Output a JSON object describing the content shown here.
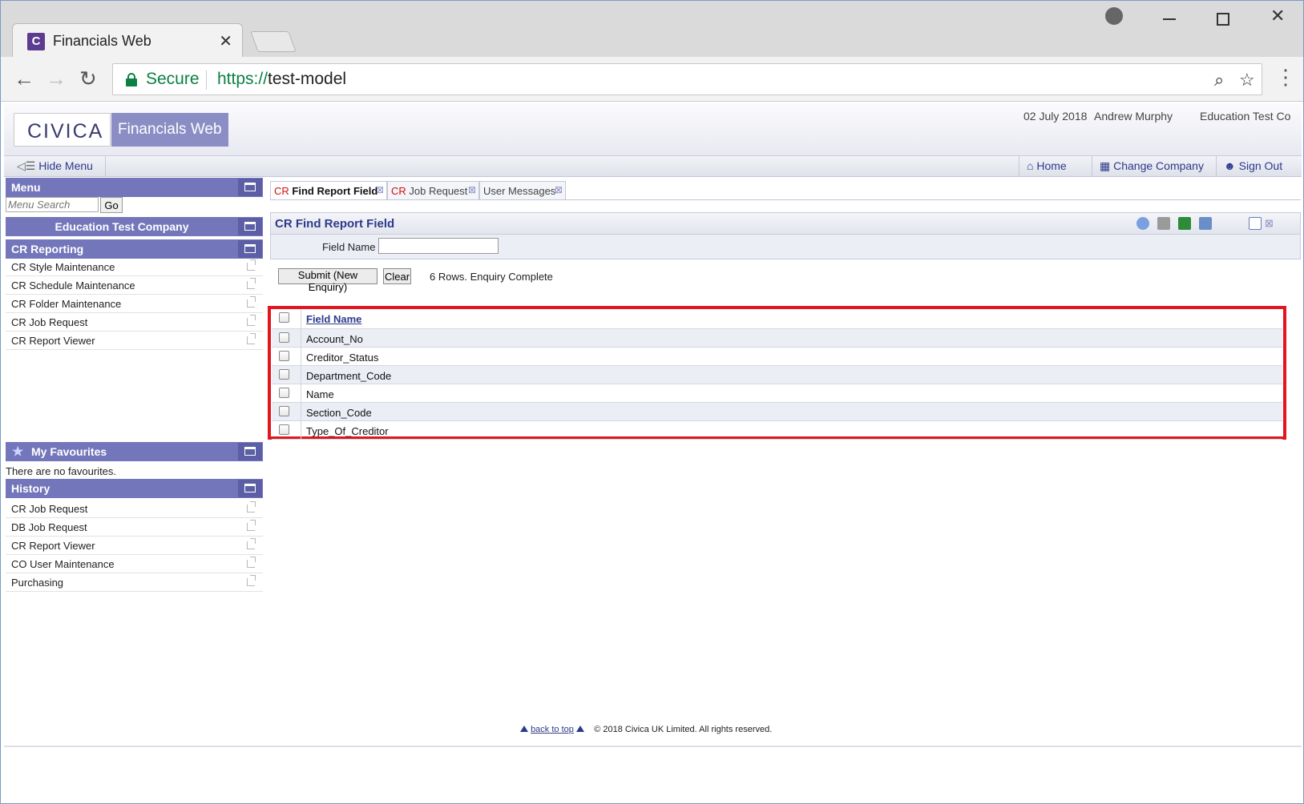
{
  "browser": {
    "tab_title": "Financials Web",
    "tab_favicon": "C",
    "tab_close": "✕",
    "secure_label": "Secure",
    "url_scheme": "https://",
    "url_host": "test-model"
  },
  "header": {
    "logo": "CIVICA",
    "product": "Financials Web",
    "date": "02 July 2018",
    "user": "Andrew Murphy",
    "company": "Education Test Co"
  },
  "toolbar": {
    "hide_menu": "Hide Menu",
    "home": "Home",
    "change_company": "Change Company",
    "sign_out": "Sign Out"
  },
  "sidebar": {
    "menu_title": "Menu",
    "search_placeholder": "Menu Search",
    "go_label": "Go",
    "company_title": "Education Test Company",
    "section_title": "CR Reporting",
    "items": [
      {
        "label": "CR Style Maintenance"
      },
      {
        "label": "CR Schedule Maintenance"
      },
      {
        "label": "CR Folder Maintenance"
      },
      {
        "label": "CR Job Request"
      },
      {
        "label": "CR Report Viewer"
      }
    ],
    "favourites_title": "My Favourites",
    "no_favourites": "There are no favourites.",
    "history_title": "History",
    "history": [
      {
        "label": "CR Job Request"
      },
      {
        "label": "DB Job Request"
      },
      {
        "label": "CR Report Viewer"
      },
      {
        "label": "CO User Maintenance"
      },
      {
        "label": "Purchasing"
      }
    ]
  },
  "content_tabs": [
    {
      "prefix": "CR",
      "label": "Find Report Field",
      "close": "⊠"
    },
    {
      "prefix": "CR",
      "label": "Job Request",
      "close": "⊠"
    },
    {
      "prefix": "",
      "label": "User Messages",
      "close": "⊠"
    }
  ],
  "form": {
    "title": "CR Find Report Field",
    "field_name_label": "Field Name",
    "field_name_value": "",
    "submit_label": "Submit (New Enquiry)",
    "clear_label": "Clear",
    "status": "6 Rows. Enquiry Complete"
  },
  "grid": {
    "header": "Field Name",
    "rows": [
      "Account_No",
      "Creditor_Status",
      "Department_Code",
      "Name",
      "Section_Code",
      "Type_Of_Creditor"
    ]
  },
  "footer": {
    "back_to_top": "back to top",
    "copyright": "© 2018 Civica UK Limited. All rights reserved."
  },
  "colors": {
    "accent": "#7376ba",
    "highlight": "#e2161f",
    "secure_green": "#0b8043",
    "link": "#2c3a8c"
  }
}
